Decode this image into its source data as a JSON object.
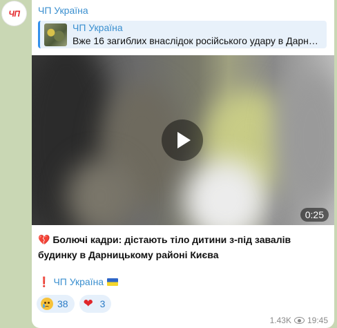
{
  "channel": {
    "avatar_text": "ЧП",
    "name": "ЧП Україна"
  },
  "reply": {
    "title": "ЧП Україна",
    "text": "Вже 16 загиблих внаслідок російського удару в Дарн…"
  },
  "video": {
    "duration": "0:25",
    "play_icon": "play-icon"
  },
  "caption": {
    "emoji": "💔",
    "text": "Болючі кадри: дістають тіло дитини з-під завалів будинку в Дарницькому районі Києва"
  },
  "footer": {
    "mark": "❗",
    "text": "ЧП Україна"
  },
  "reactions": [
    {
      "icon": "crying-face-icon",
      "count": "38"
    },
    {
      "icon": "heart-icon",
      "emoji": "❤",
      "count": "3"
    }
  ],
  "meta": {
    "views": "1.43K",
    "time": "19:45"
  },
  "colors": {
    "accent": "#3a8fcf",
    "bubble": "#ffffff",
    "background": "#c9d7b4",
    "reaction_bg": "#e6f0fb"
  }
}
